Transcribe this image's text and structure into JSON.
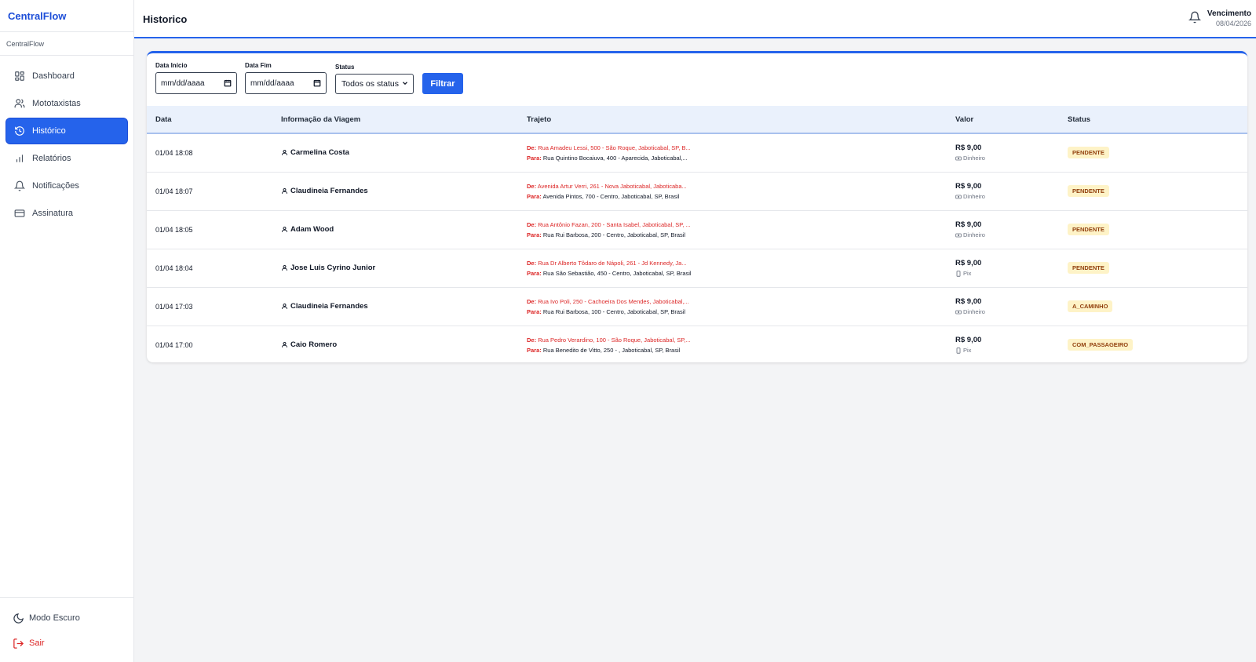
{
  "app": {
    "brand": "CentralFlow",
    "subtitle": "CentralFlow"
  },
  "sidebar": {
    "items": [
      {
        "label": "Dashboard",
        "icon": "grid-icon"
      },
      {
        "label": "Mototaxistas",
        "icon": "users-icon"
      },
      {
        "label": "Histórico",
        "icon": "history-icon",
        "active": true
      },
      {
        "label": "Relatórios",
        "icon": "bar-chart-icon"
      },
      {
        "label": "Notificações",
        "icon": "bell-icon"
      },
      {
        "label": "Assinatura",
        "icon": "credit-card-icon"
      }
    ],
    "dark_mode": "Modo Escuro",
    "logout": "Sair"
  },
  "header": {
    "title": "Historico",
    "due_label": "Vencimento",
    "due_date": "08/04/2026"
  },
  "filters": {
    "start_label": "Data Início",
    "start_value": "mm/dd/aaaa",
    "end_label": "Data Fim",
    "end_value": "mm/dd/aaaa",
    "status_label": "Status",
    "status_value": "Todos os status",
    "button": "Filtrar"
  },
  "table": {
    "columns": [
      "Data",
      "Informação da Viagem",
      "Trajeto",
      "Valor",
      "Status"
    ],
    "from_prefix": "De:",
    "to_prefix": "Para:",
    "rows": [
      {
        "date": "01/04 18:08",
        "passenger": "Carmelina Costa",
        "from": "Rua Amadeu Lessi, 500 - São Roque, Jaboticabal, SP, B...",
        "to": "Rua Quintino Bocaiuva, 400 - Aparecida, Jaboticabal,...",
        "value": "R$ 9,00",
        "payment": "Dinheiro",
        "status": "PENDENTE"
      },
      {
        "date": "01/04 18:07",
        "passenger": "Claudineia Fernandes",
        "from": "Avenida Artur Verri, 261 - Nova Jaboticabal, Jaboticaba...",
        "to": "Avenida Pintos, 700 - Centro, Jaboticabal, SP, Brasil",
        "value": "R$ 9,00",
        "payment": "Dinheiro",
        "status": "PENDENTE"
      },
      {
        "date": "01/04 18:05",
        "passenger": "Adam Wood",
        "from": "Rua Antônio Fazan, 200 - Santa Isabel, Jaboticabal, SP, ...",
        "to": "Rua Rui Barbosa, 200 - Centro, Jaboticabal, SP, Brasil",
        "value": "R$ 9,00",
        "payment": "Dinheiro",
        "status": "PENDENTE"
      },
      {
        "date": "01/04 18:04",
        "passenger": "Jose Luis Cyrino Junior",
        "from": "Rua Dr Alberto Tôdaro de Nápoli, 261 - Jd Kennedy, Ja...",
        "to": "Rua São Sebastião, 450 - Centro, Jaboticabal, SP, Brasil",
        "value": "R$ 9,00",
        "payment": "Pix",
        "status": "PENDENTE"
      },
      {
        "date": "01/04 17:03",
        "passenger": "Claudineia Fernandes",
        "from": "Rua Ivo Poli, 250 - Cachoeira Dos Mendes, Jaboticabal,...",
        "to": "Rua Rui Barbosa, 100 - Centro, Jaboticabal, SP, Brasil",
        "value": "R$ 9,00",
        "payment": "Dinheiro",
        "status": "A_CAMINHO"
      },
      {
        "date": "01/04 17:00",
        "passenger": "Caio Romero",
        "from": "Rua Pedro Verardino, 100 - São Roque, Jaboticabal, SP,...",
        "to": "Rua Benedito de Vitto, 250 - , Jaboticabal, SP, Brasil",
        "value": "R$ 9,00",
        "payment": "Pix",
        "status": "COM_PASSAGEIRO"
      }
    ]
  }
}
